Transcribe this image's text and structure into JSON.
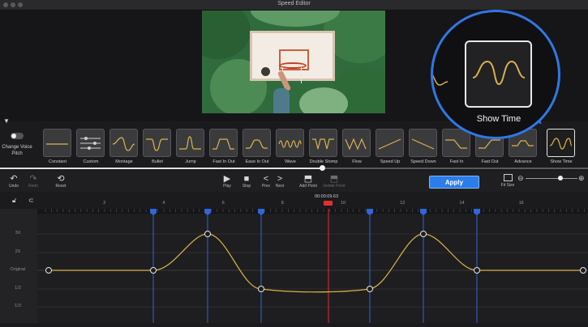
{
  "window": {
    "title": "Speed Editor"
  },
  "colors": {
    "accent": "#2b7de9",
    "curve": "#d9b24a",
    "keyframe": "#2f66d9",
    "playhead": "#e03030"
  },
  "voice_pitch": {
    "label": "Change Voice Pitch",
    "enabled": false
  },
  "presets": [
    {
      "label": "Constant",
      "icon": "constant-curve-icon"
    },
    {
      "label": "Custom",
      "icon": "custom-sliders-icon"
    },
    {
      "label": "Montage",
      "icon": "montage-curve-icon"
    },
    {
      "label": "Bullet",
      "icon": "bullet-curve-icon"
    },
    {
      "label": "Jump",
      "icon": "jump-curve-icon"
    },
    {
      "label": "Fast In Out",
      "icon": "fast-in-out-curve-icon"
    },
    {
      "label": "Ease In Out",
      "icon": "ease-in-out-curve-icon"
    },
    {
      "label": "Wave",
      "icon": "wave-curve-icon"
    },
    {
      "label": "Double Stomp",
      "icon": "double-stomp-curve-icon"
    },
    {
      "label": "Flow",
      "icon": "flow-curve-icon"
    },
    {
      "label": "Speed Up",
      "icon": "speed-up-curve-icon"
    },
    {
      "label": "Speed Down",
      "icon": "speed-down-curve-icon"
    },
    {
      "label": "Fast In",
      "icon": "fast-in-curve-icon"
    },
    {
      "label": "Fast Out",
      "icon": "fast-out-curve-icon"
    },
    {
      "label": "Advance",
      "icon": "advance-curve-icon"
    },
    {
      "label": "Show Time",
      "icon": "show-time-curve-icon",
      "selected": true
    }
  ],
  "zoom_callout": {
    "label": "Show Time"
  },
  "toolbar": {
    "undo": "Undo",
    "redo": "Redo",
    "reset": "Reset",
    "play": "Play",
    "stop": "Stop",
    "prev": "Prev",
    "next": "Next",
    "add_point": "Add Point",
    "delete_point": "Delete Point",
    "apply": "Apply",
    "fit_size": "Fit Size"
  },
  "timeline": {
    "timecode": "00:00:09.63",
    "ruler_ticks": [
      "2",
      "4",
      "6",
      "8",
      "10",
      "12",
      "14",
      "16"
    ]
  },
  "speed_axis": [
    "3X",
    "2X",
    "Original",
    "1/2",
    "1/3"
  ]
}
